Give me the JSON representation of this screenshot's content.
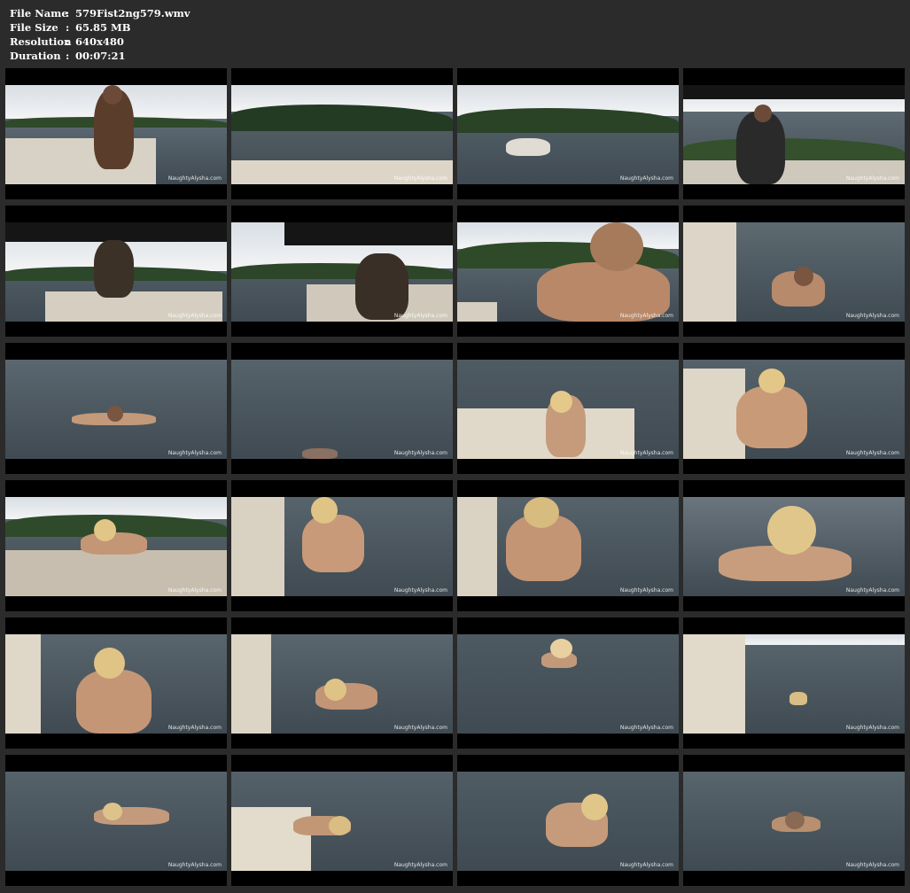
{
  "file_info": {
    "rows": [
      {
        "label": "File Name",
        "sep": ":",
        "value": "579Fist2ng579.wmv"
      },
      {
        "label": "File Size",
        "sep": ":",
        "value": "65.85 MB"
      },
      {
        "label": "Resolution",
        "sep": ":",
        "value": "640x480"
      },
      {
        "label": "Duration",
        "sep": ":",
        "value": "00:07:21"
      }
    ]
  },
  "thumbnails": {
    "watermark": "NaughtyAlysha.com",
    "count": 24,
    "columns": 4
  },
  "colors": {
    "background": "#2b2b2b",
    "thumb_bg": "#000000",
    "text": "#ffffff"
  }
}
